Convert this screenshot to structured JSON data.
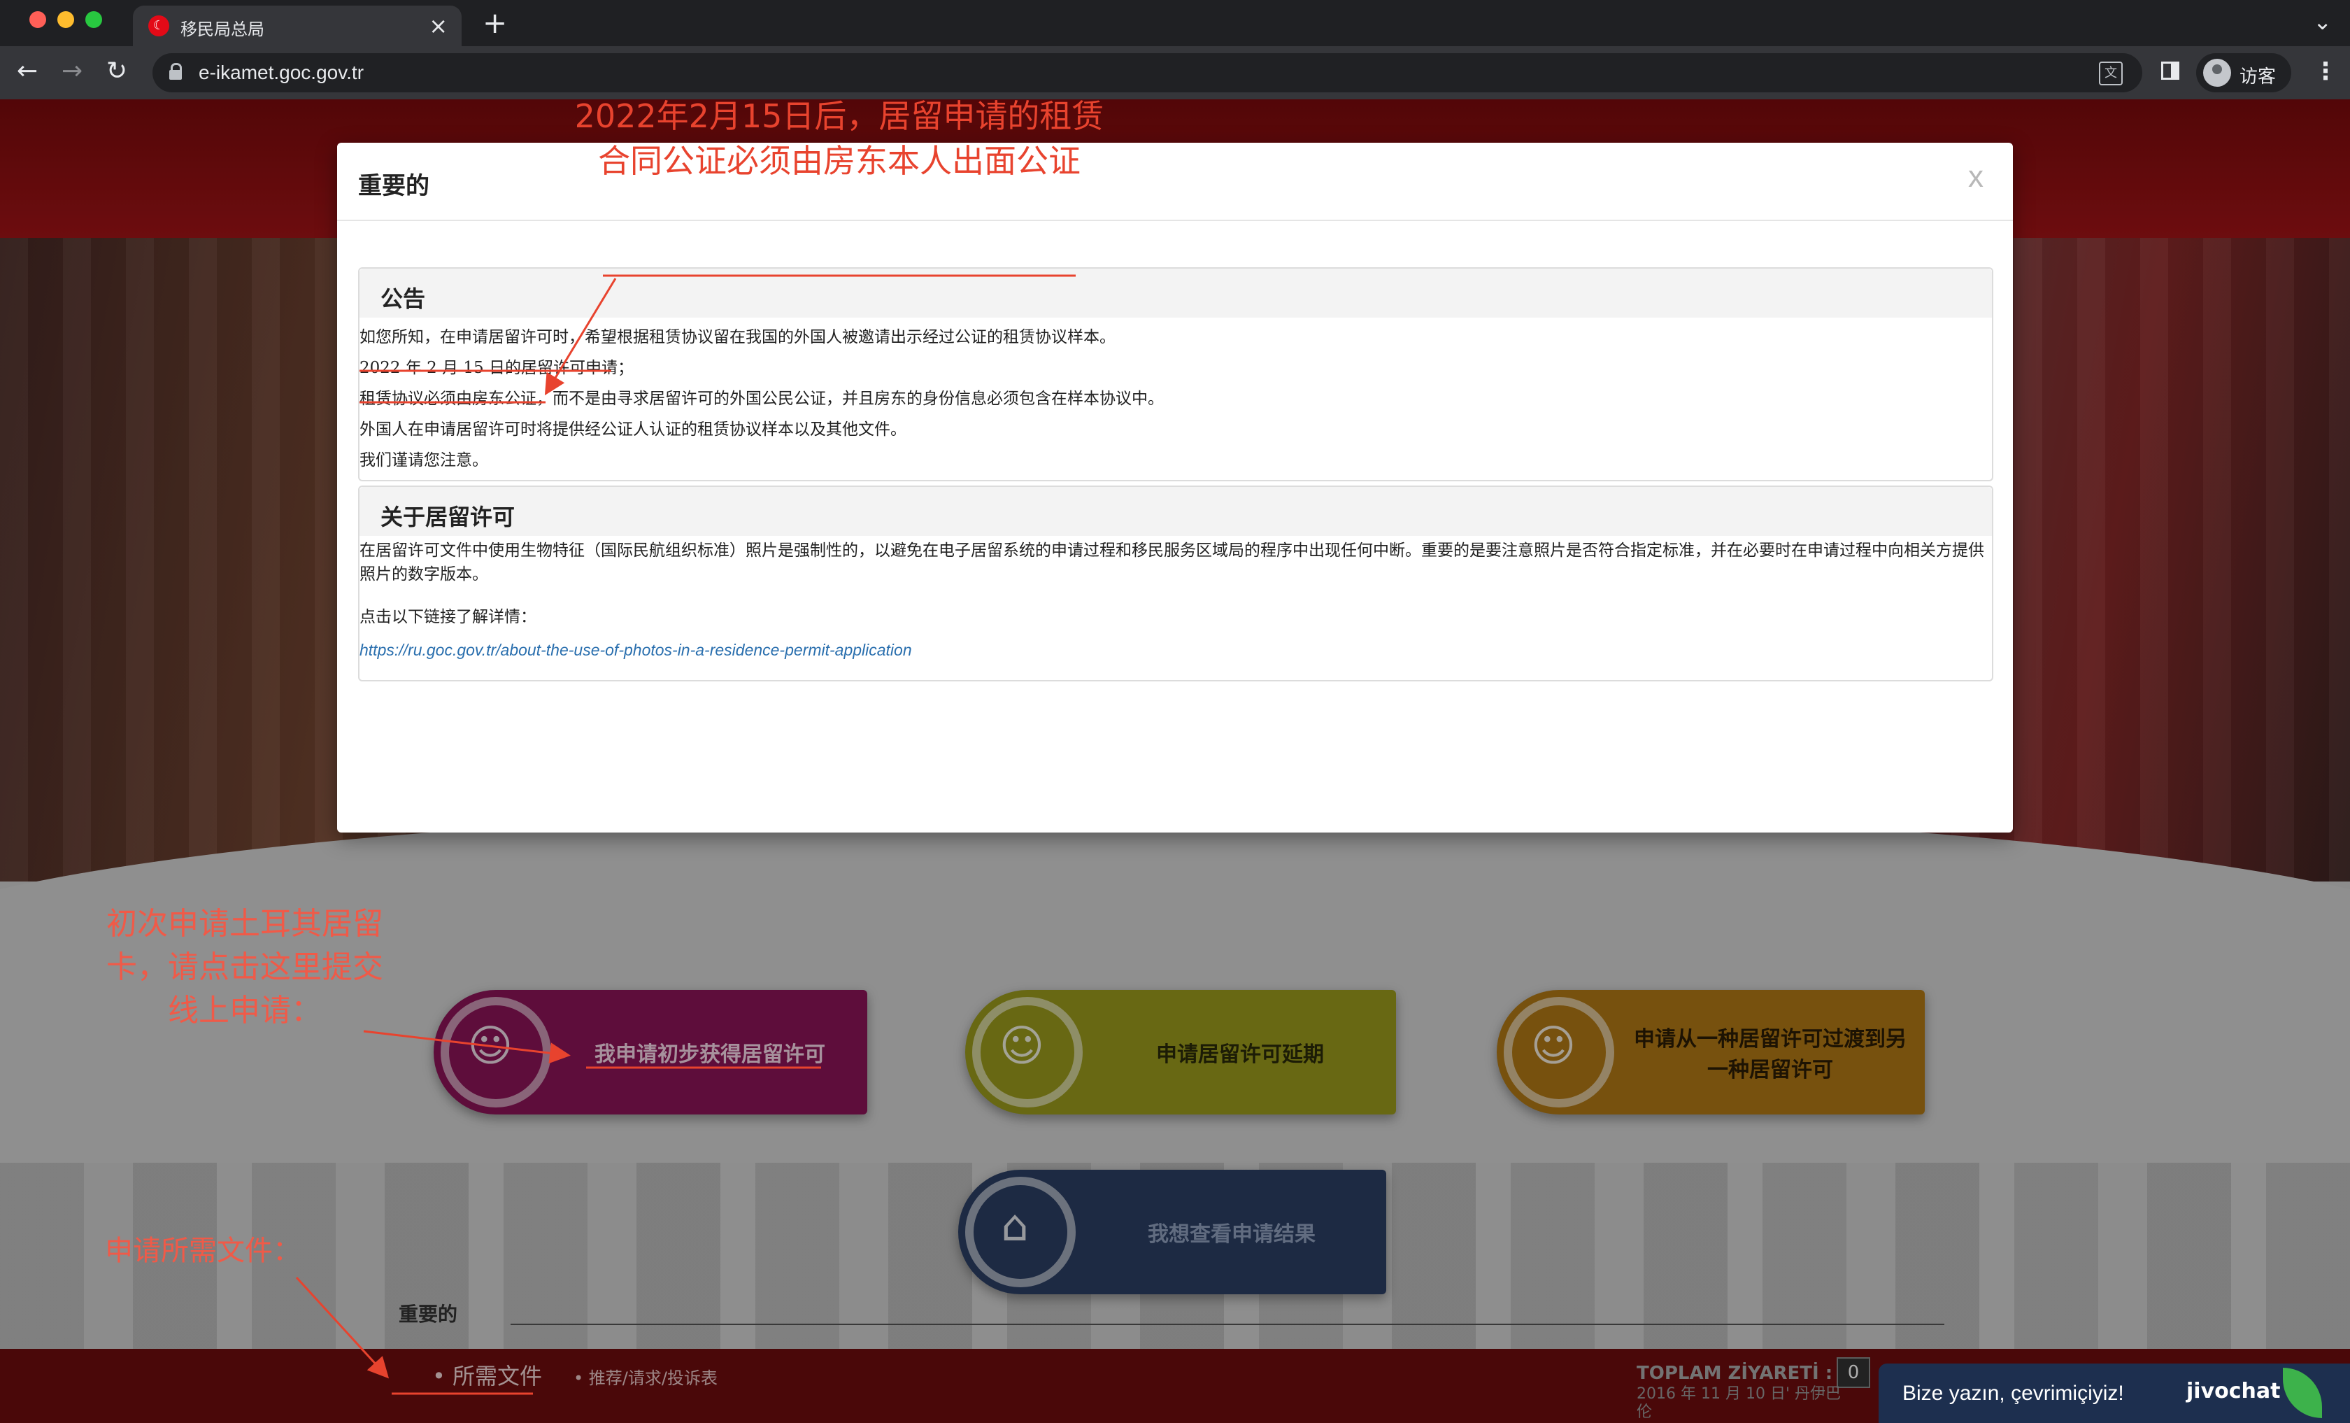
{
  "browser": {
    "tab_title": "移民局总局",
    "url": "e-ikamet.goc.gov.tr",
    "profile_label": "访客",
    "icons": [
      "back-icon",
      "forward-icon",
      "reload-icon",
      "lock-icon",
      "translate-icon",
      "side-panel-icon",
      "avatar-icon",
      "kebab-menu-icon",
      "close-icon",
      "new-tab-icon",
      "tab-search-icon"
    ]
  },
  "modal": {
    "title": "重要的",
    "close_label": "x",
    "announcement": {
      "heading": "公告",
      "lines": [
        "如您所知，在申请居留许可时，希望根据租赁协议留在我国的外国人被邀请出示经过公证的租赁协议样本。",
        "2022 年 2 月 15 日的居留许可申请；",
        "租赁协议必须由房东公证，而不是由寻求居留许可的外国公民公证，并且房东的身份信息必须包含在样本协议中。",
        "外国人在申请居留许可时将提供经公证人认证的租赁协议样本以及其他文件。",
        "我们谨请您注意。"
      ]
    },
    "about": {
      "heading": "关于居留许可",
      "text": "在居留许可文件中使用生物特征（国际民航组织标准）照片是强制性的，以避免在电子居留系统的申请过程和移民服务区域局的程序中出现任何中断。重要的是要注意照片是否符合指定标准，并在必要时在申请过程中向相关方提供照片的数字版本。",
      "click_label": "点击以下链接了解详情：",
      "link": "https://ru.goc.gov.tr/about-the-use-of-photos-in-a-residence-permit-application"
    }
  },
  "annotations": {
    "lease_note": "2022年2月15日后，居留申请的租赁合同公证必须由房东本人出面公证",
    "first_apply_note": "初次申请土耳其居留卡，请点击这里提交线上申请：",
    "docs_note": "申请所需文件："
  },
  "page": {
    "buttons": {
      "first": "我申请初步获得居留许可",
      "extend": "申请居留许可延期",
      "transfer": "申请从一种居留许可过渡到另一种居留许可",
      "result": "我想查看申请结果"
    },
    "important_label": "重要的",
    "footer": {
      "docs_link": "• 所需文件",
      "suggest_link": "• 推荐/请求/投诉表",
      "visit_label": "TOPLAM ZİYARETİ :",
      "visit_count": "0",
      "visit_date": "2016 年 11 月 10 日' 丹伊巴伦"
    },
    "chat": {
      "text": "Bize yazın, çevrimiçiyiz!",
      "brand": "jivochat"
    }
  },
  "colors": {
    "annotation_red": "#e8432e",
    "header_red": "#a11417",
    "link_blue": "#2a6fae",
    "first_button": "#8b1457",
    "extend_button": "#9a9a1c",
    "transfer_button": "#b07816",
    "result_button": "#2c3e64"
  }
}
